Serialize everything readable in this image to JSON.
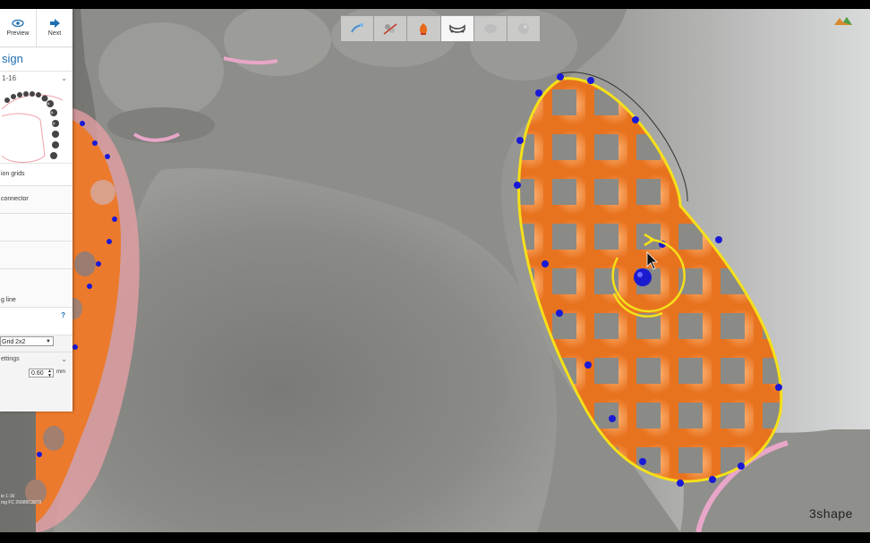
{
  "app": {
    "brand": "3shape",
    "brand_color": "#222222"
  },
  "toolbar": {
    "preview_label": "Preview",
    "next_label": "Next",
    "tools": [
      {
        "name": "model-tool",
        "icon": "tooth-model-icon",
        "active": false
      },
      {
        "name": "clasp-tool",
        "icon": "clasp-icon",
        "active": false
      },
      {
        "name": "paint-tool",
        "icon": "wax-paint-icon",
        "active": false
      },
      {
        "name": "connector-tool",
        "icon": "major-connector-icon",
        "active": true
      },
      {
        "name": "retention-tool",
        "icon": "shell-icon",
        "active": false
      },
      {
        "name": "finish-tool",
        "icon": "finish-icon",
        "active": false
      }
    ]
  },
  "panel": {
    "section_title": "sign",
    "teeth_range": "1-16",
    "items": [
      {
        "label": "ion grids",
        "selected": true
      },
      {
        "label": "connector",
        "selected": false
      },
      {
        "label": "",
        "selected": false
      },
      {
        "label": "",
        "selected": false
      },
      {
        "label": "g line",
        "selected": false
      }
    ],
    "help_label": "?",
    "grid_type": "Grid 2x2",
    "settings_label": "ettings",
    "thickness_value": "0.60",
    "thickness_unit": "mm",
    "case_line1": "ie 1-16",
    "case_line2": "mg FC 26689C3079"
  },
  "colors": {
    "accent": "#1e6fb0",
    "grid": "#ec7a2c",
    "outline": "#f5e01a",
    "control_point": "#1a1ad6",
    "model": "#8b8b86"
  }
}
